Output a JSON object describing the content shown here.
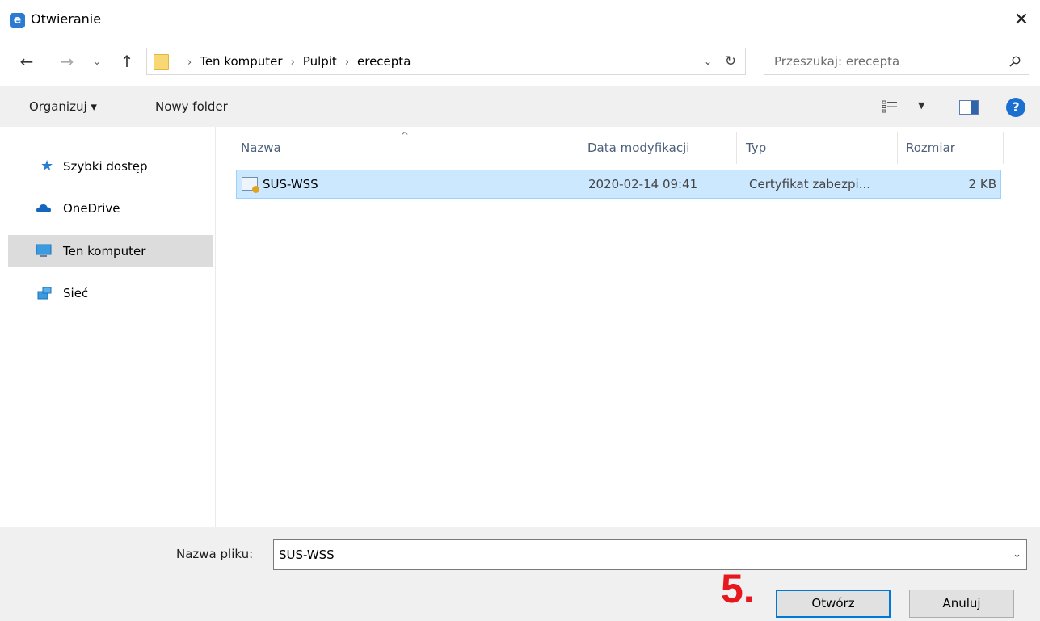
{
  "window": {
    "title": "Otwieranie",
    "app_icon_glyph": "e",
    "close_glyph": "✕"
  },
  "navigation": {
    "back_glyph": "←",
    "forward_glyph": "→",
    "recent_glyph": "⌄",
    "up_glyph": "↑",
    "breadcrumbs": [
      "Ten komputer",
      "Pulpit",
      "erecepta"
    ],
    "breadcrumb_separator": "›",
    "address_dropdown_glyph": "⌄",
    "refresh_glyph": "↻",
    "search_placeholder": "Przeszukaj: erecepta"
  },
  "toolbar": {
    "organize_label": "Organizuj ▾",
    "new_folder_label": "Nowy folder",
    "view_dropdown_glyph": "▼",
    "help_glyph": "?"
  },
  "sidebar": {
    "items": [
      {
        "label": "Szybki dostęp",
        "icon": "star-icon"
      },
      {
        "label": "OneDrive",
        "icon": "cloud-icon"
      },
      {
        "label": "Ten komputer",
        "icon": "monitor-icon",
        "selected": true
      },
      {
        "label": "Sieć",
        "icon": "network-icon"
      }
    ]
  },
  "file_list": {
    "sort_glyph": "^",
    "columns": [
      "Nazwa",
      "Data modyfikacji",
      "Typ",
      "Rozmiar"
    ],
    "rows": [
      {
        "name": "SUS-WSS",
        "date": "2020-02-14 09:41",
        "type": "Certyfikat zabezpi...",
        "size": "2 KB",
        "icon": "certificate-icon",
        "selected": true
      }
    ]
  },
  "bottom": {
    "filename_label": "Nazwa pliku:",
    "filename_value": "SUS-WSS",
    "filename_dropdown_glyph": "⌄",
    "step_marker": "5.",
    "open_label": "Otwórz",
    "cancel_label": "Anuluj"
  },
  "colors": {
    "accent": "#0078d7",
    "selection": "#cce8ff",
    "step_marker": "#e8161d"
  }
}
